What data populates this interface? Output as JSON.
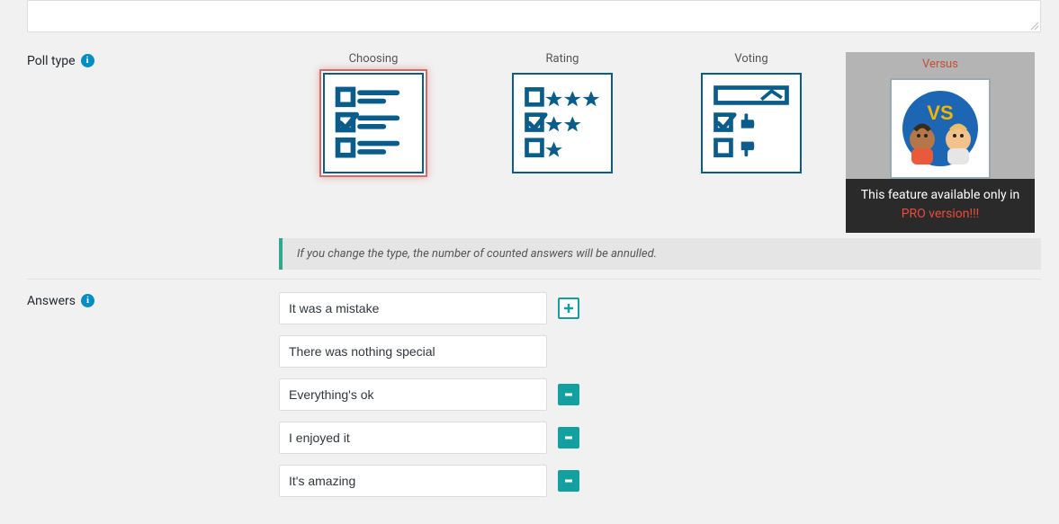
{
  "sections": {
    "poll_type": {
      "label": "Poll type"
    },
    "answers": {
      "label": "Answers"
    }
  },
  "poll_types": {
    "choosing": {
      "title": "Choosing"
    },
    "rating": {
      "title": "Rating"
    },
    "voting": {
      "title": "Voting"
    },
    "versus": {
      "title": "Versus"
    }
  },
  "pro_notice": {
    "line1": "This feature available only in",
    "line2": "PRO version!!!"
  },
  "type_change_note": "If you change the type, the number of counted answers will be annulled.",
  "answers": [
    {
      "value": "It was a mistake",
      "can_remove": false
    },
    {
      "value": "There was nothing special",
      "can_remove": false
    },
    {
      "value": "Everything's ok",
      "can_remove": true
    },
    {
      "value": "I enjoyed it",
      "can_remove": true
    },
    {
      "value": "It's amazing",
      "can_remove": true
    }
  ]
}
